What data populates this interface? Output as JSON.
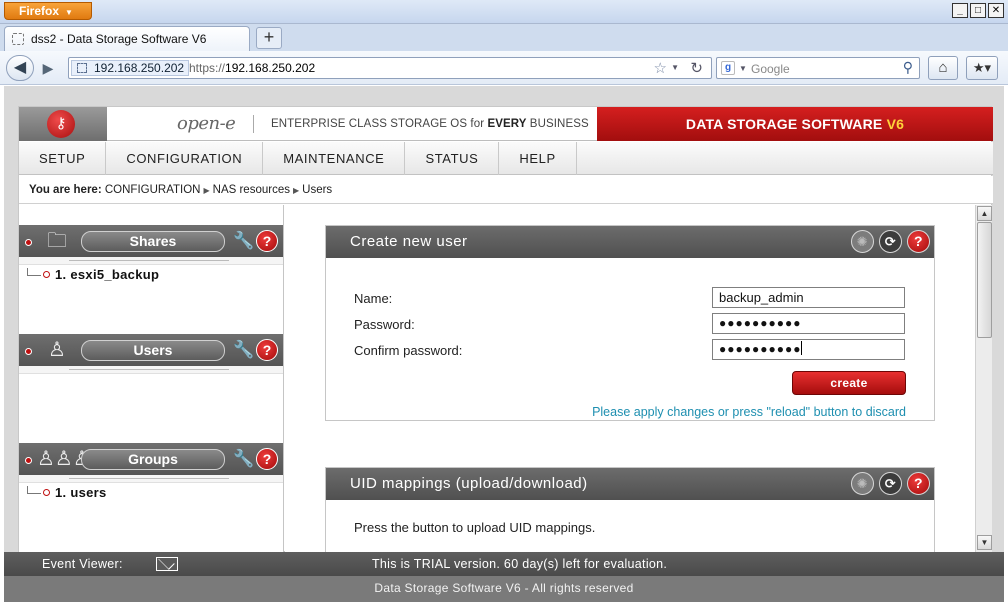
{
  "browser": {
    "app_button": "Firefox",
    "window_controls": {
      "minimize": "_",
      "maximize": "□",
      "close": "✕"
    },
    "tab_title": "dss2 - Data Storage Software V6",
    "new_tab": "+",
    "site_identity": "192.168.250.202",
    "url_scheme": "https://",
    "url_host": "192.168.250.202",
    "search_engine_letter": "g",
    "search_placeholder": "Google"
  },
  "header": {
    "brand": "open-e",
    "tagline_prefix": "ENTERPRISE CLASS STORAGE OS for",
    "tagline_bold": "EVERY",
    "tagline_suffix": "BUSINESS",
    "product": "DATA STORAGE SOFTWARE",
    "product_version": "V6"
  },
  "menu": [
    "SETUP",
    "CONFIGURATION",
    "MAINTENANCE",
    "STATUS",
    "HELP"
  ],
  "breadcrumb": {
    "label": "You are here:",
    "items": [
      "CONFIGURATION",
      "NAS resources",
      "Users"
    ]
  },
  "sidebar": {
    "panels": [
      {
        "title": "Shares",
        "items": [
          "1. esxi5_backup"
        ]
      },
      {
        "title": "Users",
        "items": []
      },
      {
        "title": "Groups",
        "items": [
          "1. users"
        ]
      }
    ]
  },
  "create_user": {
    "title": "Create new user",
    "name_label": "Name:",
    "name_value": "backup_admin",
    "password_label": "Password:",
    "password_mask": "●●●●●●●●●●",
    "confirm_label": "Confirm password:",
    "confirm_mask": "●●●●●●●●●●",
    "create_label": "create",
    "apply_message": "Please apply changes or press \"reload\" button to discard"
  },
  "uid_mappings": {
    "title": "UID mappings (upload/download)",
    "text": "Press the button to upload UID mappings."
  },
  "event_viewer": {
    "label": "Event Viewer:",
    "trial_message": "This is TRIAL version. 60 day(s) left for evaluation."
  },
  "footer": "Data Storage Software V6 - All rights reserved",
  "colors": {
    "brand_red": "#c01515",
    "version_yellow": "#ffd23a",
    "link_teal": "#1e8fb0",
    "panel_gray": "#5e5e5e"
  }
}
